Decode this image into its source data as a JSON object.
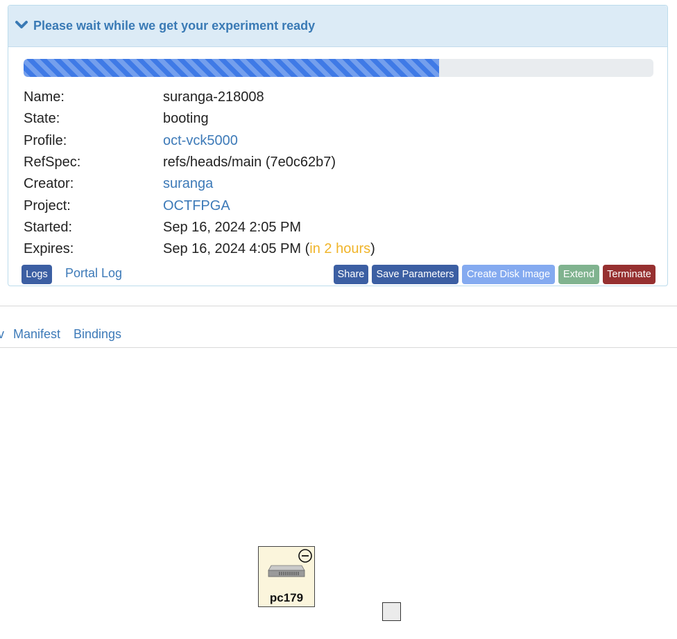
{
  "status_panel": {
    "heading": "Please wait while we get your experiment ready",
    "progress_fraction": 0.66,
    "fields": {
      "name": {
        "label": "Name:",
        "value": "suranga-218008"
      },
      "state": {
        "label": "State:",
        "value": "booting"
      },
      "profile": {
        "label": "Profile:",
        "value": "oct-vck5000"
      },
      "refspec": {
        "label": "RefSpec:",
        "value": "refs/heads/main (7e0c62b7)"
      },
      "creator": {
        "label": "Creator:",
        "value": "suranga"
      },
      "project": {
        "label": "Project:",
        "value": "OCTFPGA"
      },
      "started": {
        "label": "Started:",
        "value": "Sep 16, 2024 2:05 PM"
      },
      "expires": {
        "label": "Expires:",
        "value": "Sep 16, 2024 4:05 PM",
        "open_paren": "(",
        "relative": "in 2 hours",
        "close_paren": ")"
      }
    },
    "buttons": {
      "logs": "Logs",
      "portal_log": "Portal Log",
      "share": "Share",
      "save_parameters": "Save Parameters",
      "create_disk_image": "Create Disk Image",
      "extend": "Extend",
      "terminate": "Terminate"
    }
  },
  "tabs": {
    "partial": "v",
    "manifest": "Manifest",
    "bindings": "Bindings"
  },
  "topology": {
    "node_name": "pc179",
    "node_icon": "server-icon",
    "node_status_icon": "minus-circle-icon"
  },
  "colors": {
    "accent": "#3d7ab8",
    "progress": "#3f7ae6",
    "warning": "#f0b429",
    "btn_primary": "#3c5fa3",
    "btn_disabled": "#84aaf0",
    "btn_extend": "#80b38f",
    "btn_terminate": "#963030"
  }
}
